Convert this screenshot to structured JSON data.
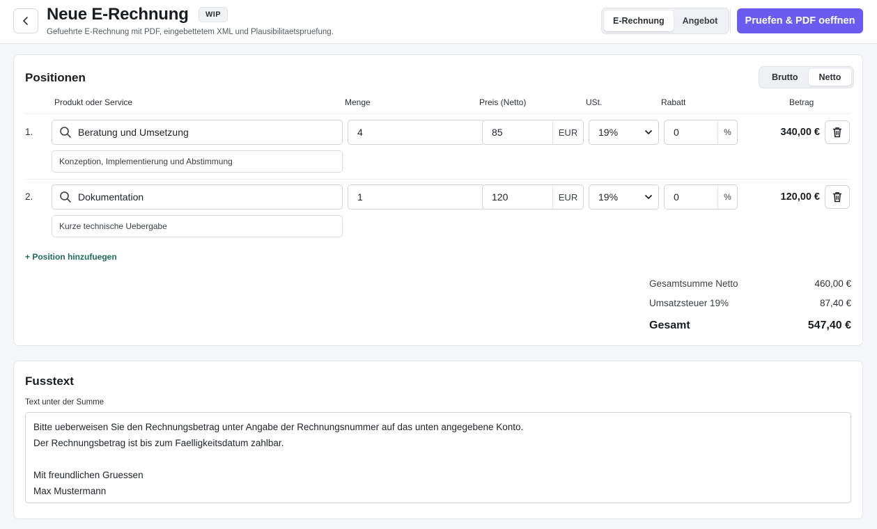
{
  "header": {
    "title": "Neue E-Rechnung",
    "badge": "WIP",
    "subtitle": "Gefuehrte E-Rechnung mit PDF, eingebettetem XML und Plausibilitaetspruefung.",
    "doc_types": [
      {
        "label": "E-Rechnung",
        "active": true
      },
      {
        "label": "Angebot",
        "active": false
      }
    ],
    "primary_action": "Pruefen & PDF oeffnen"
  },
  "positions": {
    "title": "Positionen",
    "tax_modes": [
      {
        "label": "Brutto",
        "active": false
      },
      {
        "label": "Netto",
        "active": true
      }
    ],
    "columns": {
      "product": "Produkt oder Service",
      "quantity": "Menge",
      "price": "Preis (Netto)",
      "vat": "USt.",
      "discount": "Rabatt",
      "amount": "Betrag"
    },
    "rows": [
      {
        "num": "1.",
        "product": "Beratung und Umsetzung",
        "description": "Konzeption, Implementierung und Abstimmung",
        "quantity": "4",
        "price": "85",
        "currency": "EUR",
        "vat": "19%",
        "discount": "0",
        "discount_unit": "%",
        "amount": "340,00 €"
      },
      {
        "num": "2.",
        "product": "Dokumentation",
        "description": "Kurze technische Uebergabe",
        "quantity": "1",
        "price": "120",
        "currency": "EUR",
        "vat": "19%",
        "discount": "0",
        "discount_unit": "%",
        "amount": "120,00 €"
      }
    ],
    "add_label": "+ Position hinzufuegen",
    "totals": {
      "net_label": "Gesamtsumme Netto",
      "net_value": "460,00 €",
      "vat_label": "Umsatzsteuer 19%",
      "vat_value": "87,40 €",
      "total_label": "Gesamt",
      "total_value": "547,40 €"
    }
  },
  "footer_text": {
    "title": "Fusstext",
    "label": "Text unter der Summe",
    "lines": [
      "Bitte ueberweisen Sie den Rechnungsbetrag unter Angabe der Rechnungsnummer auf das unten angegebene Konto.",
      "Der Rechnungsbetrag ist bis zum Faelligkeitsdatum zahlbar.",
      "",
      "Mit freundlichen Gruessen",
      "Max Mustermann"
    ]
  },
  "colors": {
    "accent": "#6a5cf0",
    "link": "#1e6b5c"
  },
  "icons": [
    "chevron-left-icon",
    "search-icon",
    "trash-icon",
    "chevron-down-icon"
  ]
}
